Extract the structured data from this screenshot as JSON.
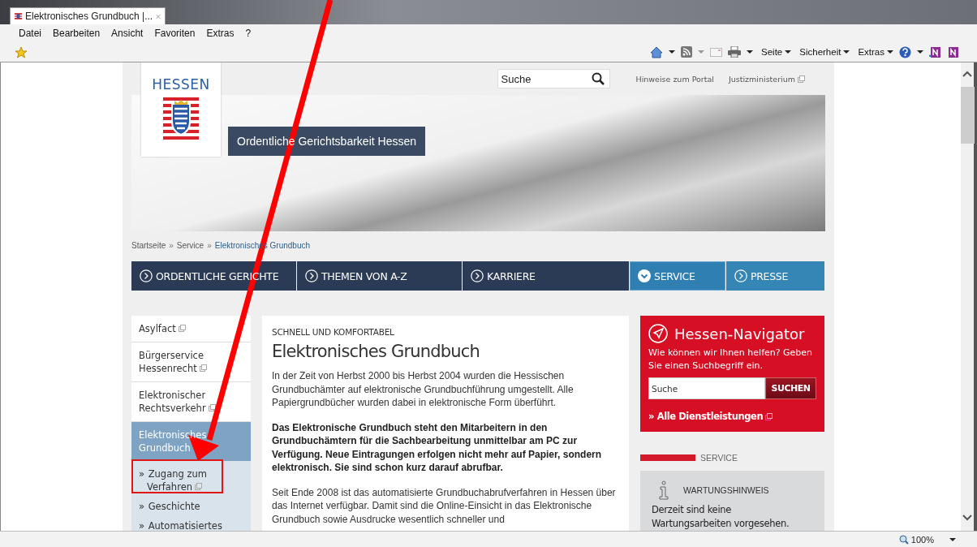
{
  "browser": {
    "tab_title": "Elektronisches Grundbuch |...",
    "menu": [
      "Datei",
      "Bearbeiten",
      "Ansicht",
      "Favoriten",
      "Extras",
      "?"
    ],
    "toolbar_menus": [
      "Seite",
      "Sicherheit",
      "Extras"
    ],
    "zoom": "100%"
  },
  "header": {
    "logo_text": "HESSEN",
    "search_placeholder": "Suche",
    "links": [
      {
        "label": "Hinweise zum Portal",
        "external": false
      },
      {
        "label": "Justizministerium",
        "external": true
      }
    ],
    "banner_title": "Ordentliche Gerichtsbarkeit Hessen"
  },
  "breadcrumb": [
    {
      "label": "Startseite",
      "current": false
    },
    {
      "prefix": "»",
      "label": "Service",
      "current": false
    },
    {
      "prefix": "»",
      "label": "Elektronisches Grundbuch",
      "current": true
    }
  ],
  "nav": [
    {
      "label": "ORDENTLICHE GERICHTE",
      "selected": false,
      "color": "#2b3a55"
    },
    {
      "label": "THEMEN VON A-Z",
      "selected": false,
      "color": "#2b3a55"
    },
    {
      "label": "KARRIERE",
      "selected": false,
      "color": "#2b3a55"
    },
    {
      "label": "SERVICE",
      "selected": true,
      "color": "#2f7fb3"
    },
    {
      "label": "PRESSE",
      "selected": false,
      "color": "#3585b5"
    }
  ],
  "sidebar": [
    {
      "label": "Asylfact",
      "external": true,
      "selected": false
    },
    {
      "label": "Bürgerservice Hessenrecht",
      "external": true,
      "selected": false
    },
    {
      "label": "Elektronischer Rechtsverkehr",
      "external": true,
      "selected": false
    },
    {
      "label": "Elektronisches Grundbuch",
      "external": false,
      "selected": true,
      "children": [
        {
          "bullet": "»",
          "label": "Zugang zum Verfahren",
          "external": true
        },
        {
          "bullet": "»",
          "label": "Geschichte",
          "external": false
        },
        {
          "bullet": "»",
          "label": "Automatisiertes",
          "external": false
        }
      ]
    }
  ],
  "article": {
    "kicker": "SCHNELL UND KOMFORTABEL",
    "title": "Elektronisches Grundbuch",
    "paragraphs": [
      {
        "text": "In der Zeit von Herbst 2000 bis Herbst 2004 wurden die Hessischen Grundbuchämter auf elektronische Grundbuchführung umgestellt. Alle Papiergrundbücher wurden dabei in elektronische Form überführt.",
        "bold": false
      },
      {
        "text": "Das Elektronische Grundbuch steht den Mitarbeitern in den Grundbuchämtern für die Sachbearbeitung unmittelbar am PC zur Verfügung. Neue Eintragungen erfolgen nicht mehr auf Papier, sondern elektronisch. Sie sind schon kurz darauf abrufbar.",
        "bold": true
      },
      {
        "text": "Seit Ende 2008 ist das automatisierte Grundbuchabrufverfahren in Hessen über das Internet verfügbar. Damit sind die Online-Einsicht in das Elektronische Grundbuch sowie Ausdrucke wesentlich schneller und",
        "bold": false
      }
    ]
  },
  "navigator": {
    "title": "Hessen-Navigator",
    "text": "Wie können wir Ihnen helfen? Geben Sie einen Suchbegriff ein.",
    "search_placeholder": "Suche",
    "button": "SUCHEN",
    "link": "» Alle Dienstleistungen"
  },
  "service": {
    "heading": "SERVICE",
    "notice_title": "WARTUNGSHINWEIS",
    "notice_text": "Derzeit sind keine Wartungsarbeiten vorgesehen."
  }
}
